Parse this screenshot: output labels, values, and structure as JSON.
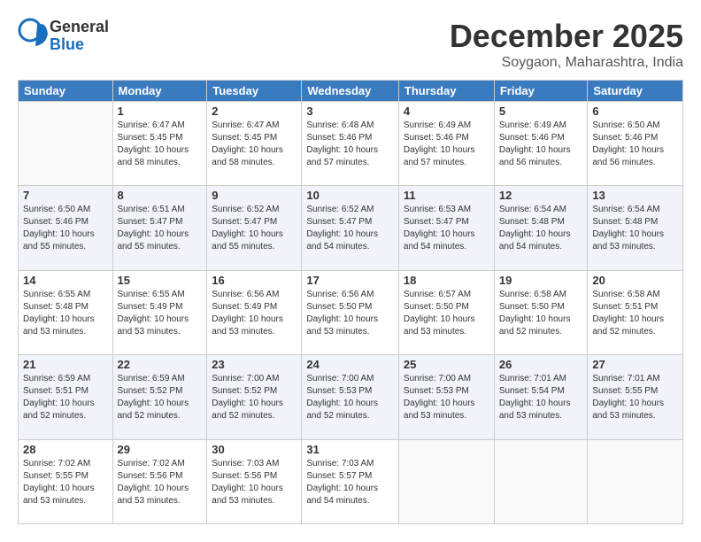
{
  "logo": {
    "general": "General",
    "blue": "Blue"
  },
  "title": "December 2025",
  "location": "Soygaon, Maharashtra, India",
  "headers": [
    "Sunday",
    "Monday",
    "Tuesday",
    "Wednesday",
    "Thursday",
    "Friday",
    "Saturday"
  ],
  "rows": [
    [
      {
        "day": "",
        "info": ""
      },
      {
        "day": "1",
        "info": "Sunrise: 6:47 AM\nSunset: 5:45 PM\nDaylight: 10 hours\nand 58 minutes."
      },
      {
        "day": "2",
        "info": "Sunrise: 6:47 AM\nSunset: 5:45 PM\nDaylight: 10 hours\nand 58 minutes."
      },
      {
        "day": "3",
        "info": "Sunrise: 6:48 AM\nSunset: 5:46 PM\nDaylight: 10 hours\nand 57 minutes."
      },
      {
        "day": "4",
        "info": "Sunrise: 6:49 AM\nSunset: 5:46 PM\nDaylight: 10 hours\nand 57 minutes."
      },
      {
        "day": "5",
        "info": "Sunrise: 6:49 AM\nSunset: 5:46 PM\nDaylight: 10 hours\nand 56 minutes."
      },
      {
        "day": "6",
        "info": "Sunrise: 6:50 AM\nSunset: 5:46 PM\nDaylight: 10 hours\nand 56 minutes."
      }
    ],
    [
      {
        "day": "7",
        "info": "Sunrise: 6:50 AM\nSunset: 5:46 PM\nDaylight: 10 hours\nand 55 minutes."
      },
      {
        "day": "8",
        "info": "Sunrise: 6:51 AM\nSunset: 5:47 PM\nDaylight: 10 hours\nand 55 minutes."
      },
      {
        "day": "9",
        "info": "Sunrise: 6:52 AM\nSunset: 5:47 PM\nDaylight: 10 hours\nand 55 minutes."
      },
      {
        "day": "10",
        "info": "Sunrise: 6:52 AM\nSunset: 5:47 PM\nDaylight: 10 hours\nand 54 minutes."
      },
      {
        "day": "11",
        "info": "Sunrise: 6:53 AM\nSunset: 5:47 PM\nDaylight: 10 hours\nand 54 minutes."
      },
      {
        "day": "12",
        "info": "Sunrise: 6:54 AM\nSunset: 5:48 PM\nDaylight: 10 hours\nand 54 minutes."
      },
      {
        "day": "13",
        "info": "Sunrise: 6:54 AM\nSunset: 5:48 PM\nDaylight: 10 hours\nand 53 minutes."
      }
    ],
    [
      {
        "day": "14",
        "info": "Sunrise: 6:55 AM\nSunset: 5:48 PM\nDaylight: 10 hours\nand 53 minutes."
      },
      {
        "day": "15",
        "info": "Sunrise: 6:55 AM\nSunset: 5:49 PM\nDaylight: 10 hours\nand 53 minutes."
      },
      {
        "day": "16",
        "info": "Sunrise: 6:56 AM\nSunset: 5:49 PM\nDaylight: 10 hours\nand 53 minutes."
      },
      {
        "day": "17",
        "info": "Sunrise: 6:56 AM\nSunset: 5:50 PM\nDaylight: 10 hours\nand 53 minutes."
      },
      {
        "day": "18",
        "info": "Sunrise: 6:57 AM\nSunset: 5:50 PM\nDaylight: 10 hours\nand 53 minutes."
      },
      {
        "day": "19",
        "info": "Sunrise: 6:58 AM\nSunset: 5:50 PM\nDaylight: 10 hours\nand 52 minutes."
      },
      {
        "day": "20",
        "info": "Sunrise: 6:58 AM\nSunset: 5:51 PM\nDaylight: 10 hours\nand 52 minutes."
      }
    ],
    [
      {
        "day": "21",
        "info": "Sunrise: 6:59 AM\nSunset: 5:51 PM\nDaylight: 10 hours\nand 52 minutes."
      },
      {
        "day": "22",
        "info": "Sunrise: 6:59 AM\nSunset: 5:52 PM\nDaylight: 10 hours\nand 52 minutes."
      },
      {
        "day": "23",
        "info": "Sunrise: 7:00 AM\nSunset: 5:52 PM\nDaylight: 10 hours\nand 52 minutes."
      },
      {
        "day": "24",
        "info": "Sunrise: 7:00 AM\nSunset: 5:53 PM\nDaylight: 10 hours\nand 52 minutes."
      },
      {
        "day": "25",
        "info": "Sunrise: 7:00 AM\nSunset: 5:53 PM\nDaylight: 10 hours\nand 53 minutes."
      },
      {
        "day": "26",
        "info": "Sunrise: 7:01 AM\nSunset: 5:54 PM\nDaylight: 10 hours\nand 53 minutes."
      },
      {
        "day": "27",
        "info": "Sunrise: 7:01 AM\nSunset: 5:55 PM\nDaylight: 10 hours\nand 53 minutes."
      }
    ],
    [
      {
        "day": "28",
        "info": "Sunrise: 7:02 AM\nSunset: 5:55 PM\nDaylight: 10 hours\nand 53 minutes."
      },
      {
        "day": "29",
        "info": "Sunrise: 7:02 AM\nSunset: 5:56 PM\nDaylight: 10 hours\nand 53 minutes."
      },
      {
        "day": "30",
        "info": "Sunrise: 7:03 AM\nSunset: 5:56 PM\nDaylight: 10 hours\nand 53 minutes."
      },
      {
        "day": "31",
        "info": "Sunrise: 7:03 AM\nSunset: 5:57 PM\nDaylight: 10 hours\nand 54 minutes."
      },
      {
        "day": "",
        "info": ""
      },
      {
        "day": "",
        "info": ""
      },
      {
        "day": "",
        "info": ""
      }
    ]
  ]
}
